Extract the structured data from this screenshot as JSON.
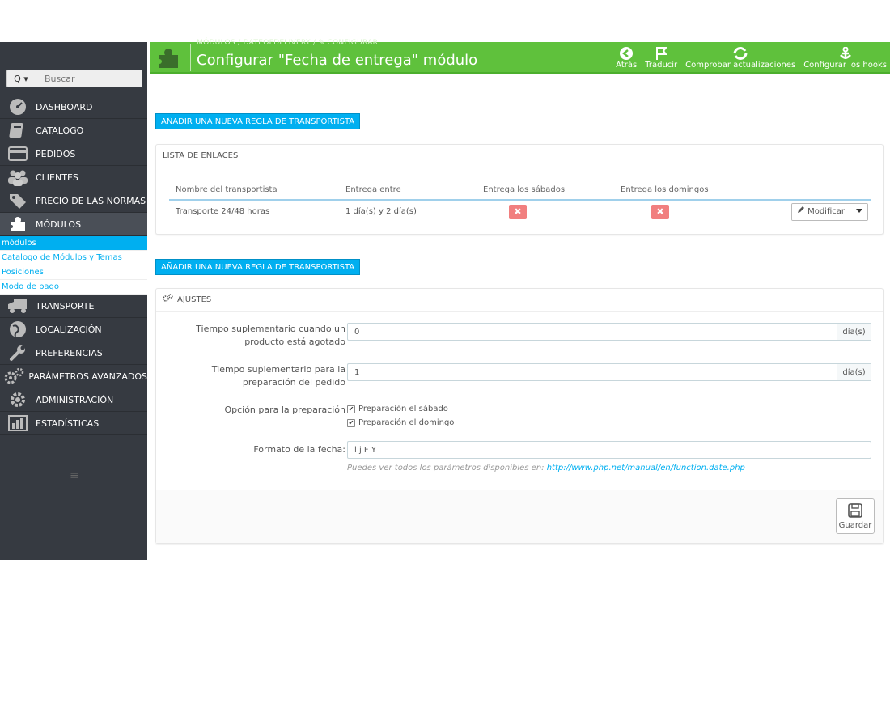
{
  "header": {
    "breadcrumb": "MÓDULOS  /  DATEOFDELIVERY  /  ✎ CONFIGURAR",
    "title": "Configurar \"Fecha de entrega\" módulo",
    "toolbar": [
      {
        "label": "Atrás",
        "icon": "back-icon"
      },
      {
        "label": "Traducir",
        "icon": "flag-icon"
      },
      {
        "label": "Comprobar actualizaciones",
        "icon": "refresh-icon"
      },
      {
        "label": "Configurar los hooks",
        "icon": "anchor-icon"
      }
    ]
  },
  "sidebar": {
    "search": {
      "button_label": "Q ▾",
      "placeholder": "Buscar"
    },
    "items": [
      {
        "label": "DASHBOARD",
        "icon": "dashboard-icon"
      },
      {
        "label": "CATALOGO",
        "icon": "book-icon"
      },
      {
        "label": "PEDIDOS",
        "icon": "credit-card-icon"
      },
      {
        "label": "CLIENTES",
        "icon": "users-icon"
      },
      {
        "label": "PRECIO DE LAS NORMAS",
        "icon": "tag-icon"
      },
      {
        "label": "MÓDULOS",
        "icon": "puzzle-icon"
      }
    ],
    "sub_items": [
      {
        "label": "módulos",
        "active": true
      },
      {
        "label": "Catalogo de Módulos y Temas"
      },
      {
        "label": "Posiciones"
      },
      {
        "label": "Modo de pago"
      }
    ],
    "items_after": [
      {
        "label": "TRANSPORTE",
        "icon": "truck-icon"
      },
      {
        "label": "LOCALIZACIÓN",
        "icon": "globe-icon"
      },
      {
        "label": "PREFERENCIAS",
        "icon": "wrench-icon"
      },
      {
        "label": "PARÁMETROS AVANZADOS",
        "icon": "cogs-icon"
      },
      {
        "label": "ADMINISTRACIÓN",
        "icon": "cog-icon"
      },
      {
        "label": "ESTADÍSTICAS",
        "icon": "bar-chart-icon"
      }
    ],
    "collapse_label": "≡"
  },
  "main": {
    "add_rule_label": "AÑADIR UNA NUEVA REGLA DE TRANSPORTISTA",
    "links_panel": {
      "heading": "LISTA DE ENLACES",
      "columns": [
        "Nombre del transportista",
        "Entrega entre",
        "Entrega los sábados",
        "Entrega los domingos",
        ""
      ],
      "rows": [
        {
          "carrier": "Transporte 24/48 horas",
          "between": "1 día(s) y 2 día(s)",
          "saturday": "✖",
          "sunday": "✖",
          "action": "Modificar"
        }
      ]
    },
    "settings_panel": {
      "heading": "AJUSTES",
      "fields": {
        "out_of_stock_label": "Tiempo suplementario cuando un producto está agotado",
        "out_of_stock_value": "0",
        "out_of_stock_unit": "día(s)",
        "prep_label": "Tiempo suplementario para la preparación del pedido",
        "prep_value": "1",
        "prep_unit": "día(s)",
        "prep_option_label": "Opción para la preparación",
        "saturday_label": "Preparación el sábado",
        "sunday_label": "Preparación el domingo",
        "date_format_label": "Formato de la fecha:",
        "date_format_value": "l j F Y",
        "help_text": "Puedes ver todos los parámetros disponibles en: ",
        "help_link": "http://www.php.net/manual/en/function.date.php"
      },
      "save_label": "Guardar"
    }
  },
  "colors": {
    "header_green": "#5fc13c",
    "accent_blue": "#00aff0",
    "sidebar_dark": "#363a41",
    "danger": "#f17f7f"
  }
}
